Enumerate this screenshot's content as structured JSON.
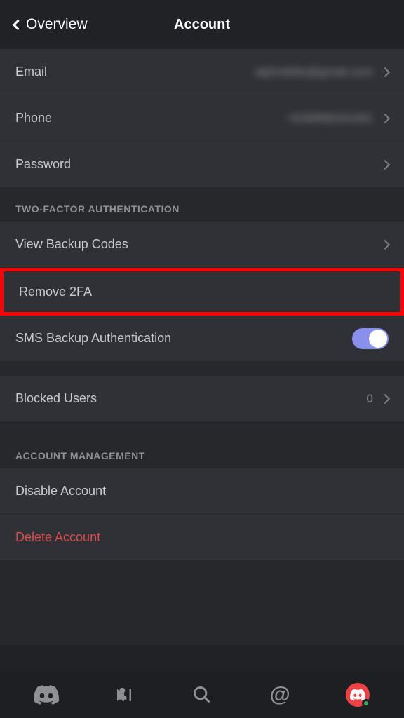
{
  "header": {
    "back_label": "Overview",
    "title": "Account"
  },
  "account": {
    "email_label": "Email",
    "email_value": "alphrdelle@gmail.com",
    "phone_label": "Phone",
    "phone_value": "+639968341061",
    "password_label": "Password"
  },
  "twofa": {
    "section_title": "TWO-FACTOR AUTHENTICATION",
    "view_backup": "View Backup Codes",
    "remove_2fa": "Remove 2FA",
    "sms_backup": "SMS Backup Authentication",
    "sms_enabled": true
  },
  "blocked": {
    "label": "Blocked Users",
    "count": "0"
  },
  "management": {
    "section_title": "ACCOUNT MANAGEMENT",
    "disable": "Disable Account",
    "delete": "Delete Account"
  }
}
